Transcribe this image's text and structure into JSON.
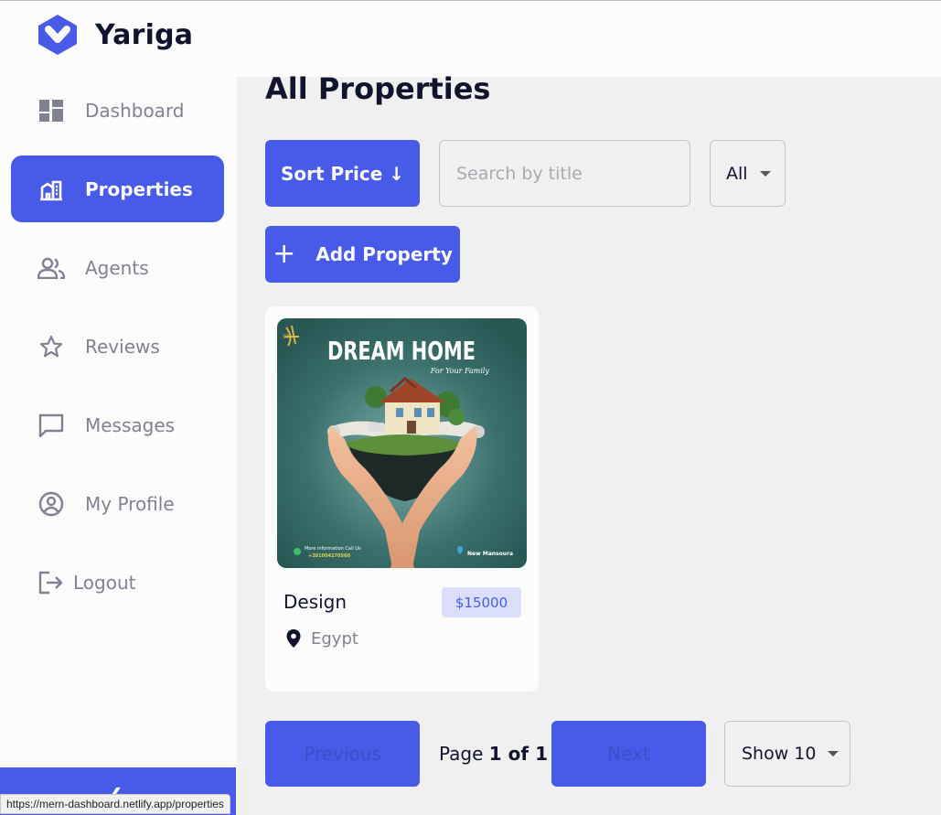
{
  "brand": {
    "name": "Yariga",
    "accent": "#475be8"
  },
  "sidebar": {
    "items": [
      {
        "label": "Dashboard",
        "icon": "dashboard-icon",
        "active": false
      },
      {
        "label": "Properties",
        "icon": "building-icon",
        "active": true
      },
      {
        "label": "Agents",
        "icon": "people-icon",
        "active": false
      },
      {
        "label": "Reviews",
        "icon": "star-icon",
        "active": false
      },
      {
        "label": "Messages",
        "icon": "chat-icon",
        "active": false
      },
      {
        "label": "My Profile",
        "icon": "user-circle-icon",
        "active": false
      },
      {
        "label": "Logout",
        "icon": "logout-icon",
        "active": false
      }
    ],
    "collapse_icon": "chevron-left-icon"
  },
  "status_url": "https://mern-dashboard.netlify.app/properties",
  "main": {
    "title": "All Properties",
    "sort_label": "Sort Price ↓",
    "search_placeholder": "Search by title",
    "type_filter_value": "All",
    "add_label": "Add Property"
  },
  "property": {
    "title": "Design",
    "price": "$15000",
    "location": "Egypt",
    "image": {
      "headline": "DREAM HOME",
      "tagline": "For Your Family",
      "contact_label": "More information Call Us",
      "phone": "+201004270560",
      "place": "New Mansoura",
      "logo_text": "SK"
    }
  },
  "pagination": {
    "previous_label": "Previous",
    "page_prefix": "Page",
    "page_value": "1 of 1",
    "next_label": "Next",
    "page_size_value": "Show 10"
  }
}
